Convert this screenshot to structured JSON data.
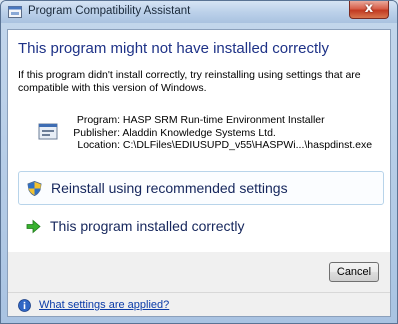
{
  "window": {
    "title": "Program Compatibility Assistant",
    "close_glyph": "x"
  },
  "main": {
    "heading": "This program might not have installed correctly",
    "description": "If this program didn't install correctly, try reinstalling using settings that are compatible with this version of Windows.",
    "program": {
      "program_label": "Program:",
      "program_value": "HASP SRM Run-time Environment Installer",
      "publisher_label": "Publisher:",
      "publisher_value": "Aladdin Knowledge Systems Ltd.",
      "location_label": "Location:",
      "location_value": "C:\\DLFiles\\EDIUSUPD_v55\\HASPWi...\\haspdinst.exe"
    },
    "options": [
      {
        "label": "Reinstall using recommended settings",
        "icon": "shield-icon"
      },
      {
        "label": "This program installed correctly",
        "icon": "green-arrow-icon"
      }
    ]
  },
  "footer": {
    "cancel_label": "Cancel",
    "help_link": "What settings are applied?",
    "help_icon": "info-icon"
  },
  "colors": {
    "heading": "#1e3287",
    "link": "#0a3ba8",
    "close_button": "#c23a22"
  }
}
